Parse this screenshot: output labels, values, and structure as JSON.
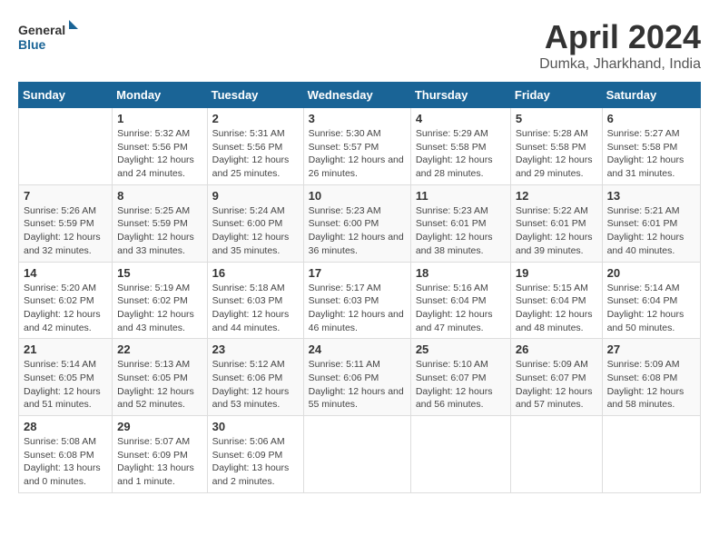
{
  "header": {
    "logo_line1": "General",
    "logo_line2": "Blue",
    "month": "April 2024",
    "location": "Dumka, Jharkhand, India"
  },
  "columns": [
    "Sunday",
    "Monday",
    "Tuesday",
    "Wednesday",
    "Thursday",
    "Friday",
    "Saturday"
  ],
  "weeks": [
    [
      {
        "day": "",
        "sunrise": "",
        "sunset": "",
        "daylight": ""
      },
      {
        "day": "1",
        "sunrise": "Sunrise: 5:32 AM",
        "sunset": "Sunset: 5:56 PM",
        "daylight": "Daylight: 12 hours and 24 minutes."
      },
      {
        "day": "2",
        "sunrise": "Sunrise: 5:31 AM",
        "sunset": "Sunset: 5:56 PM",
        "daylight": "Daylight: 12 hours and 25 minutes."
      },
      {
        "day": "3",
        "sunrise": "Sunrise: 5:30 AM",
        "sunset": "Sunset: 5:57 PM",
        "daylight": "Daylight: 12 hours and 26 minutes."
      },
      {
        "day": "4",
        "sunrise": "Sunrise: 5:29 AM",
        "sunset": "Sunset: 5:58 PM",
        "daylight": "Daylight: 12 hours and 28 minutes."
      },
      {
        "day": "5",
        "sunrise": "Sunrise: 5:28 AM",
        "sunset": "Sunset: 5:58 PM",
        "daylight": "Daylight: 12 hours and 29 minutes."
      },
      {
        "day": "6",
        "sunrise": "Sunrise: 5:27 AM",
        "sunset": "Sunset: 5:58 PM",
        "daylight": "Daylight: 12 hours and 31 minutes."
      }
    ],
    [
      {
        "day": "7",
        "sunrise": "Sunrise: 5:26 AM",
        "sunset": "Sunset: 5:59 PM",
        "daylight": "Daylight: 12 hours and 32 minutes."
      },
      {
        "day": "8",
        "sunrise": "Sunrise: 5:25 AM",
        "sunset": "Sunset: 5:59 PM",
        "daylight": "Daylight: 12 hours and 33 minutes."
      },
      {
        "day": "9",
        "sunrise": "Sunrise: 5:24 AM",
        "sunset": "Sunset: 6:00 PM",
        "daylight": "Daylight: 12 hours and 35 minutes."
      },
      {
        "day": "10",
        "sunrise": "Sunrise: 5:23 AM",
        "sunset": "Sunset: 6:00 PM",
        "daylight": "Daylight: 12 hours and 36 minutes."
      },
      {
        "day": "11",
        "sunrise": "Sunrise: 5:23 AM",
        "sunset": "Sunset: 6:01 PM",
        "daylight": "Daylight: 12 hours and 38 minutes."
      },
      {
        "day": "12",
        "sunrise": "Sunrise: 5:22 AM",
        "sunset": "Sunset: 6:01 PM",
        "daylight": "Daylight: 12 hours and 39 minutes."
      },
      {
        "day": "13",
        "sunrise": "Sunrise: 5:21 AM",
        "sunset": "Sunset: 6:01 PM",
        "daylight": "Daylight: 12 hours and 40 minutes."
      }
    ],
    [
      {
        "day": "14",
        "sunrise": "Sunrise: 5:20 AM",
        "sunset": "Sunset: 6:02 PM",
        "daylight": "Daylight: 12 hours and 42 minutes."
      },
      {
        "day": "15",
        "sunrise": "Sunrise: 5:19 AM",
        "sunset": "Sunset: 6:02 PM",
        "daylight": "Daylight: 12 hours and 43 minutes."
      },
      {
        "day": "16",
        "sunrise": "Sunrise: 5:18 AM",
        "sunset": "Sunset: 6:03 PM",
        "daylight": "Daylight: 12 hours and 44 minutes."
      },
      {
        "day": "17",
        "sunrise": "Sunrise: 5:17 AM",
        "sunset": "Sunset: 6:03 PM",
        "daylight": "Daylight: 12 hours and 46 minutes."
      },
      {
        "day": "18",
        "sunrise": "Sunrise: 5:16 AM",
        "sunset": "Sunset: 6:04 PM",
        "daylight": "Daylight: 12 hours and 47 minutes."
      },
      {
        "day": "19",
        "sunrise": "Sunrise: 5:15 AM",
        "sunset": "Sunset: 6:04 PM",
        "daylight": "Daylight: 12 hours and 48 minutes."
      },
      {
        "day": "20",
        "sunrise": "Sunrise: 5:14 AM",
        "sunset": "Sunset: 6:04 PM",
        "daylight": "Daylight: 12 hours and 50 minutes."
      }
    ],
    [
      {
        "day": "21",
        "sunrise": "Sunrise: 5:14 AM",
        "sunset": "Sunset: 6:05 PM",
        "daylight": "Daylight: 12 hours and 51 minutes."
      },
      {
        "day": "22",
        "sunrise": "Sunrise: 5:13 AM",
        "sunset": "Sunset: 6:05 PM",
        "daylight": "Daylight: 12 hours and 52 minutes."
      },
      {
        "day": "23",
        "sunrise": "Sunrise: 5:12 AM",
        "sunset": "Sunset: 6:06 PM",
        "daylight": "Daylight: 12 hours and 53 minutes."
      },
      {
        "day": "24",
        "sunrise": "Sunrise: 5:11 AM",
        "sunset": "Sunset: 6:06 PM",
        "daylight": "Daylight: 12 hours and 55 minutes."
      },
      {
        "day": "25",
        "sunrise": "Sunrise: 5:10 AM",
        "sunset": "Sunset: 6:07 PM",
        "daylight": "Daylight: 12 hours and 56 minutes."
      },
      {
        "day": "26",
        "sunrise": "Sunrise: 5:09 AM",
        "sunset": "Sunset: 6:07 PM",
        "daylight": "Daylight: 12 hours and 57 minutes."
      },
      {
        "day": "27",
        "sunrise": "Sunrise: 5:09 AM",
        "sunset": "Sunset: 6:08 PM",
        "daylight": "Daylight: 12 hours and 58 minutes."
      }
    ],
    [
      {
        "day": "28",
        "sunrise": "Sunrise: 5:08 AM",
        "sunset": "Sunset: 6:08 PM",
        "daylight": "Daylight: 13 hours and 0 minutes."
      },
      {
        "day": "29",
        "sunrise": "Sunrise: 5:07 AM",
        "sunset": "Sunset: 6:09 PM",
        "daylight": "Daylight: 13 hours and 1 minute."
      },
      {
        "day": "30",
        "sunrise": "Sunrise: 5:06 AM",
        "sunset": "Sunset: 6:09 PM",
        "daylight": "Daylight: 13 hours and 2 minutes."
      },
      {
        "day": "",
        "sunrise": "",
        "sunset": "",
        "daylight": ""
      },
      {
        "day": "",
        "sunrise": "",
        "sunset": "",
        "daylight": ""
      },
      {
        "day": "",
        "sunrise": "",
        "sunset": "",
        "daylight": ""
      },
      {
        "day": "",
        "sunrise": "",
        "sunset": "",
        "daylight": ""
      }
    ]
  ]
}
